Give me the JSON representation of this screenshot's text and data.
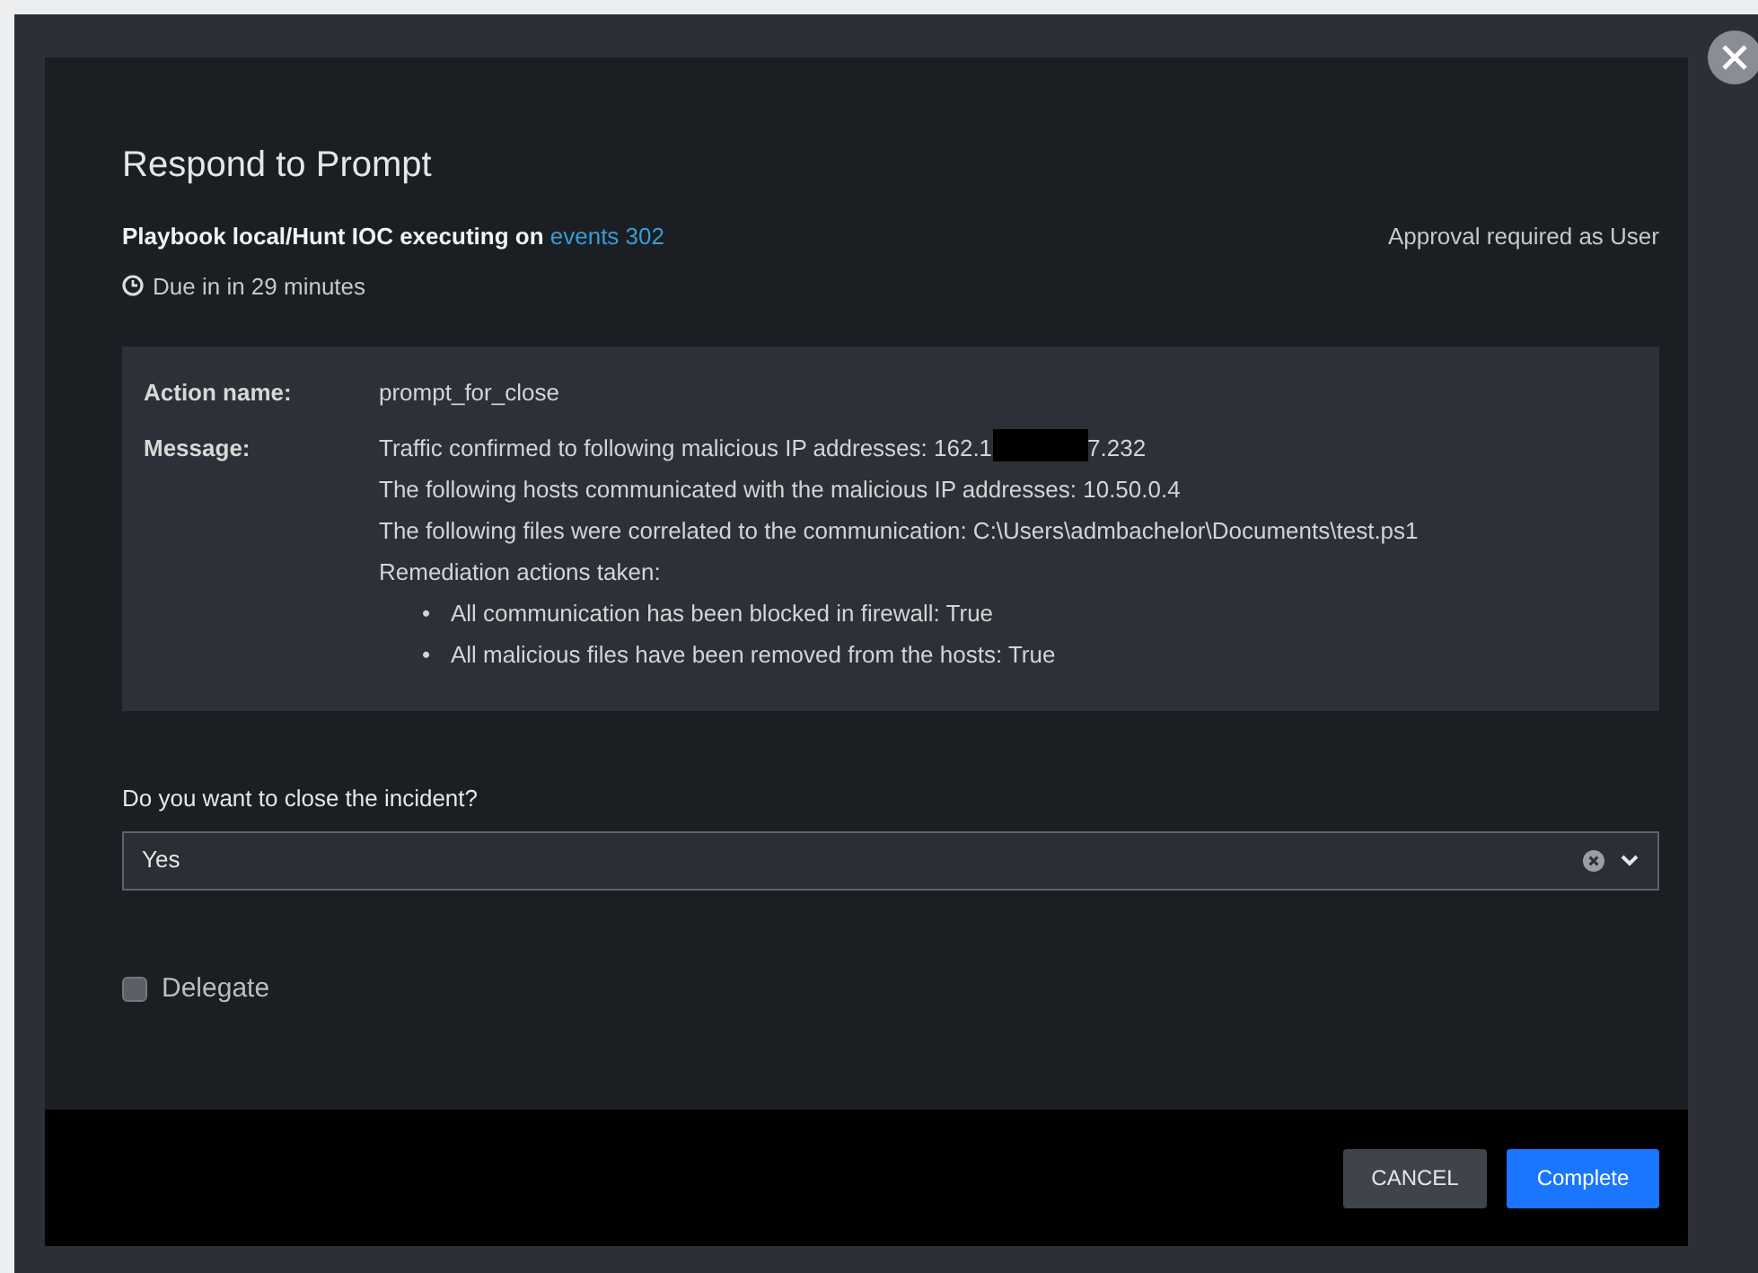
{
  "modal": {
    "title": "Respond to Prompt",
    "playbook": {
      "text": "Playbook local/Hunt IOC executing on",
      "link": "events 302"
    },
    "approval": "Approval required as User",
    "due": "Due in in 29 minutes"
  },
  "details": [
    {
      "kind": "text",
      "label": "Action name:",
      "value": "prompt_for_close"
    },
    {
      "kind": "message",
      "label": "Message:",
      "lines": [
        [
          {
            "kind": "text",
            "text": "Traffic confirmed to following malicious IP addresses: 162.1"
          },
          {
            "kind": "redaction"
          },
          {
            "kind": "text",
            "text": "7.232"
          }
        ],
        [
          {
            "kind": "text",
            "text": "The following hosts communicated with the malicious IP addresses: 10.50.0.4"
          }
        ],
        [
          {
            "kind": "text",
            "text": "The following files were correlated to the communication: C:\\Users\\admbachelor\\Documents\\test.ps1"
          }
        ],
        [
          {
            "kind": "text",
            "text": "Remediation actions taken:"
          }
        ]
      ],
      "bullets": [
        {
          "marker": "•",
          "text": "All communication has been blocked in firewall: True"
        },
        {
          "marker": "•",
          "text": "All malicious files have been removed from the hosts: True"
        }
      ]
    }
  ],
  "question": {
    "label": "Do you want to close the incident?",
    "value": "Yes"
  },
  "delegate": {
    "label": "Delegate",
    "checked": false
  },
  "buttons": [
    {
      "kind": "secondary",
      "label": "CANCEL"
    },
    {
      "kind": "primary",
      "label": "Complete"
    }
  ]
}
